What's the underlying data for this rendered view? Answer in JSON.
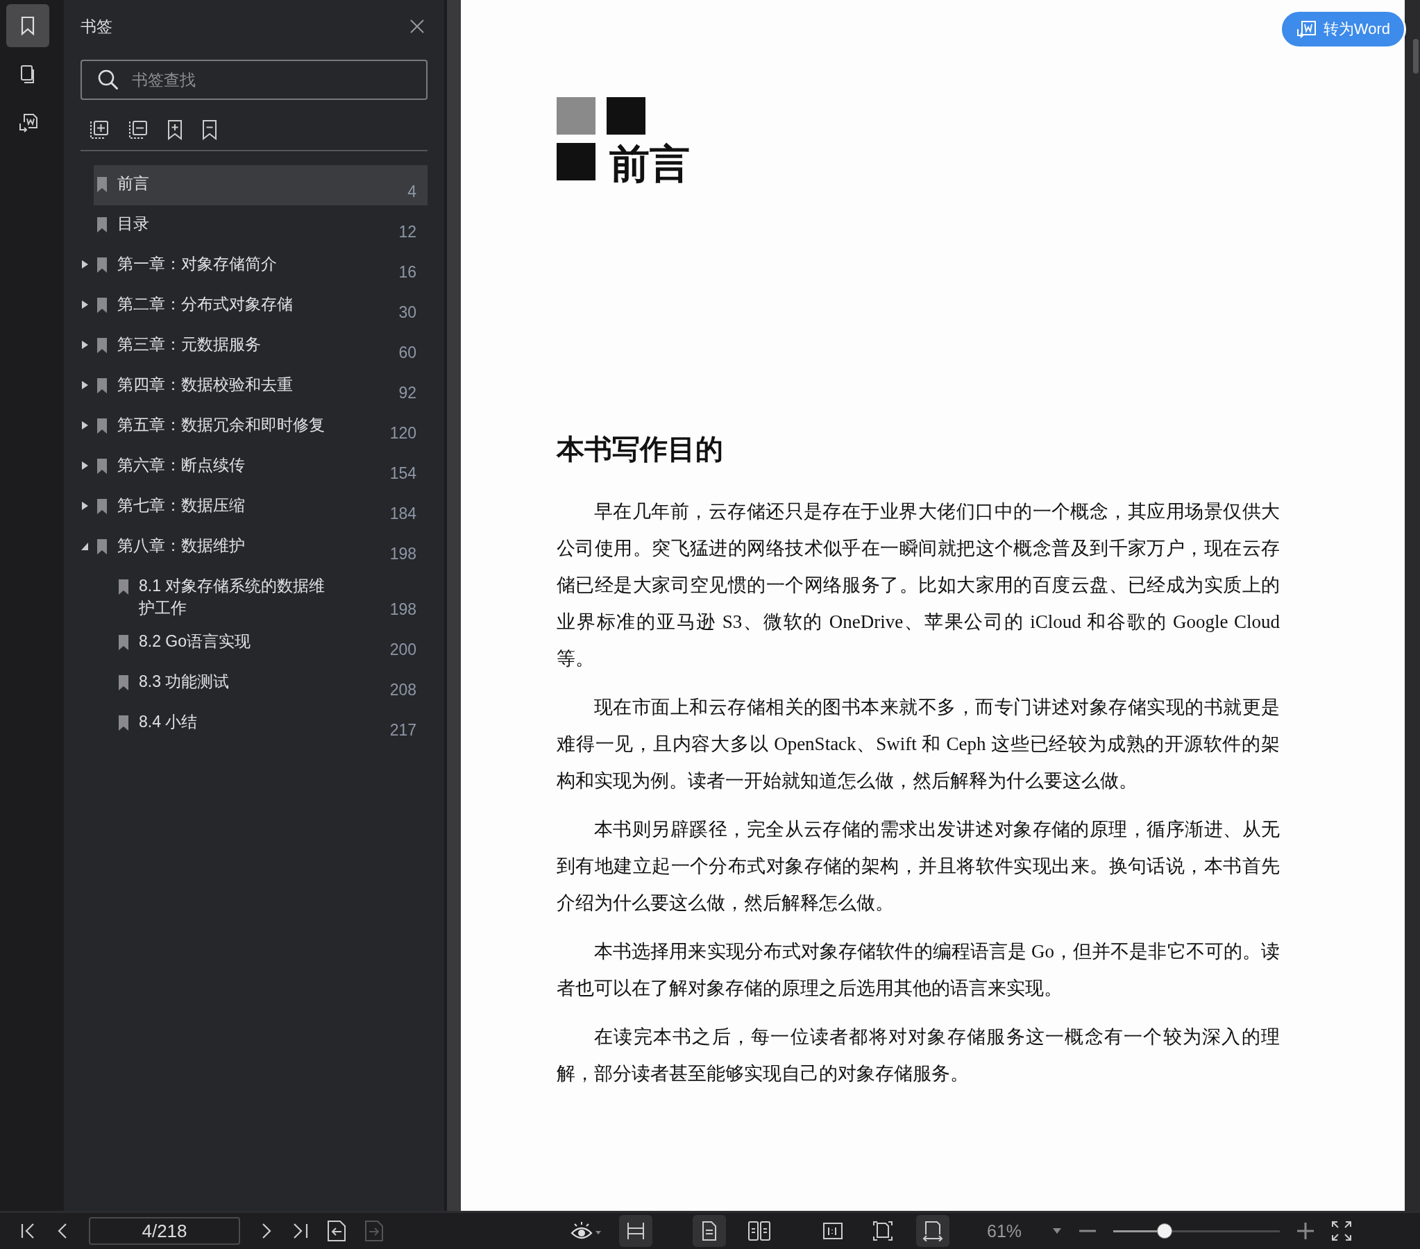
{
  "rail": [
    {
      "selected": true
    },
    {
      "selected": false
    },
    {
      "selected": false
    }
  ],
  "sidebar": {
    "title": "书签",
    "search": {
      "placeholder": "书签查找"
    },
    "bookmarks": [
      {
        "label": "前言",
        "page": "4",
        "selected": true
      },
      {
        "label": "目录",
        "page": "12",
        "selected": false
      },
      {
        "label": "第一章：对象存储简介",
        "page": "16",
        "selected": false,
        "expanded": false
      },
      {
        "label": "第二章：分布式对象存储",
        "page": "30",
        "selected": false,
        "expanded": false
      },
      {
        "label": "第三章：元数据服务",
        "page": "60",
        "selected": false,
        "expanded": false
      },
      {
        "label": "第四章：数据校验和去重",
        "page": "92",
        "selected": false,
        "expanded": false
      },
      {
        "label": "第五章：数据冗余和即时修复",
        "page": "120",
        "selected": false,
        "expanded": false
      },
      {
        "label": "第六章：断点续传",
        "page": "154",
        "selected": false,
        "expanded": false
      },
      {
        "label": "第七章：数据压缩",
        "page": "184",
        "selected": false,
        "expanded": false
      },
      {
        "label": "第八章：数据维护",
        "page": "198",
        "selected": false,
        "expanded": true,
        "children": [
          {
            "label": "8.1 对象存储系统的数据维护工作",
            "page": "198",
            "selected": false
          },
          {
            "label": "8.2 Go语言实现",
            "page": "200",
            "selected": false
          },
          {
            "label": "8.3 功能测试",
            "page": "208",
            "selected": false
          },
          {
            "label": "8.4 小结",
            "page": "217",
            "selected": false
          }
        ]
      }
    ]
  },
  "convert_button": {
    "label": "转为Word"
  },
  "page": {
    "chapter_title": "前言",
    "heading": "本书写作目的",
    "paragraphs": [
      "早在几年前，云存储还只是存在于业界大佬们口中的一个概念，其应用场景仅供大公司使用。突飞猛进的网络技术似乎在一瞬间就把这个概念普及到千家万户，现在云存储已经是大家司空见惯的一个网络服务了。比如大家用的百度云盘、已经成为实质上的业界标准的亚马逊 S3、微软的 OneDrive、苹果公司的 iCloud 和谷歌的 Google Cloud 等。",
      "现在市面上和云存储相关的图书本来就不多，而专门讲述对象存储实现的书就更是难得一见，且内容大多以 OpenStack、Swift 和 Ceph 这些已经较为成熟的开源软件的架构和实现为例。读者一开始就知道怎么做，然后解释为什么要这么做。",
      "本书则另辟蹊径，完全从云存储的需求出发讲述对象存储的原理，循序渐进、从无到有地建立起一个分布式对象存储的架构，并且将软件实现出来。换句话说，本书首先介绍为什么要这么做，然后解释怎么做。",
      "本书选择用来实现分布式对象存储软件的编程语言是 Go，但并不是非它不可的。读者也可以在了解对象存储的原理之后选用其他的语言来实现。",
      "在读完本书之后，每一位读者都将对对象存储服务这一概念有一个较为深入的理解，部分读者甚至能够实现自己的对象存储服务。"
    ]
  },
  "toolbar": {
    "page_field": "4/218",
    "history": [
      {
        "disabled": false
      },
      {
        "disabled": true
      }
    ],
    "layout_modes": [
      {
        "selected": true
      }
    ],
    "page_modes": [
      {
        "selected": true
      },
      {
        "selected": false
      }
    ],
    "fit_modes": [
      {
        "selected": false
      },
      {
        "selected": false
      },
      {
        "selected": true
      }
    ],
    "zoom": {
      "value": "61%",
      "level": 0.31
    }
  }
}
